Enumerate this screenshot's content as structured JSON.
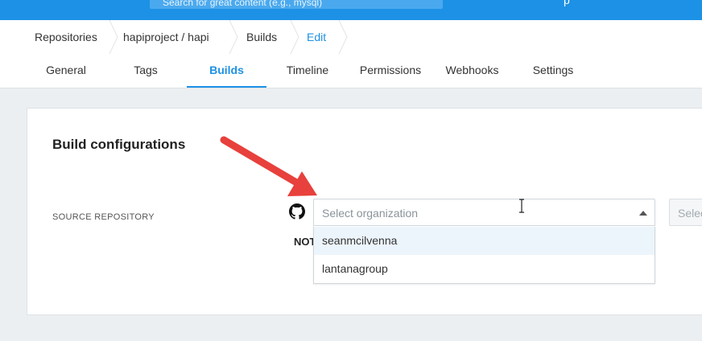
{
  "topbar": {
    "search_text": "Search for great content (e.g., mysql)",
    "user_text": "p"
  },
  "breadcrumb": {
    "items": [
      "Repositories",
      "hapiproject / hapi",
      "Builds",
      "Edit"
    ]
  },
  "tabs": [
    "General",
    "Tags",
    "Builds",
    "Timeline",
    "Permissions",
    "Webhooks",
    "Settings"
  ],
  "active_tab": "Builds",
  "card": {
    "title": "Build configurations",
    "source_label": "SOURCE REPOSITORY",
    "note_text": "NOT"
  },
  "org_select": {
    "placeholder": "Select organization",
    "options": [
      "seanmcilvenna",
      "lantanagroup"
    ]
  },
  "repo_select": {
    "placeholder": "Select"
  },
  "icons": {
    "source": "github-icon",
    "annotation": "red-arrow",
    "pointer": "text-cursor-icon"
  },
  "colors": {
    "brand_blue": "#1d91e5",
    "arrow_red": "#e8403c",
    "option_highlight": "#edf5fc"
  }
}
